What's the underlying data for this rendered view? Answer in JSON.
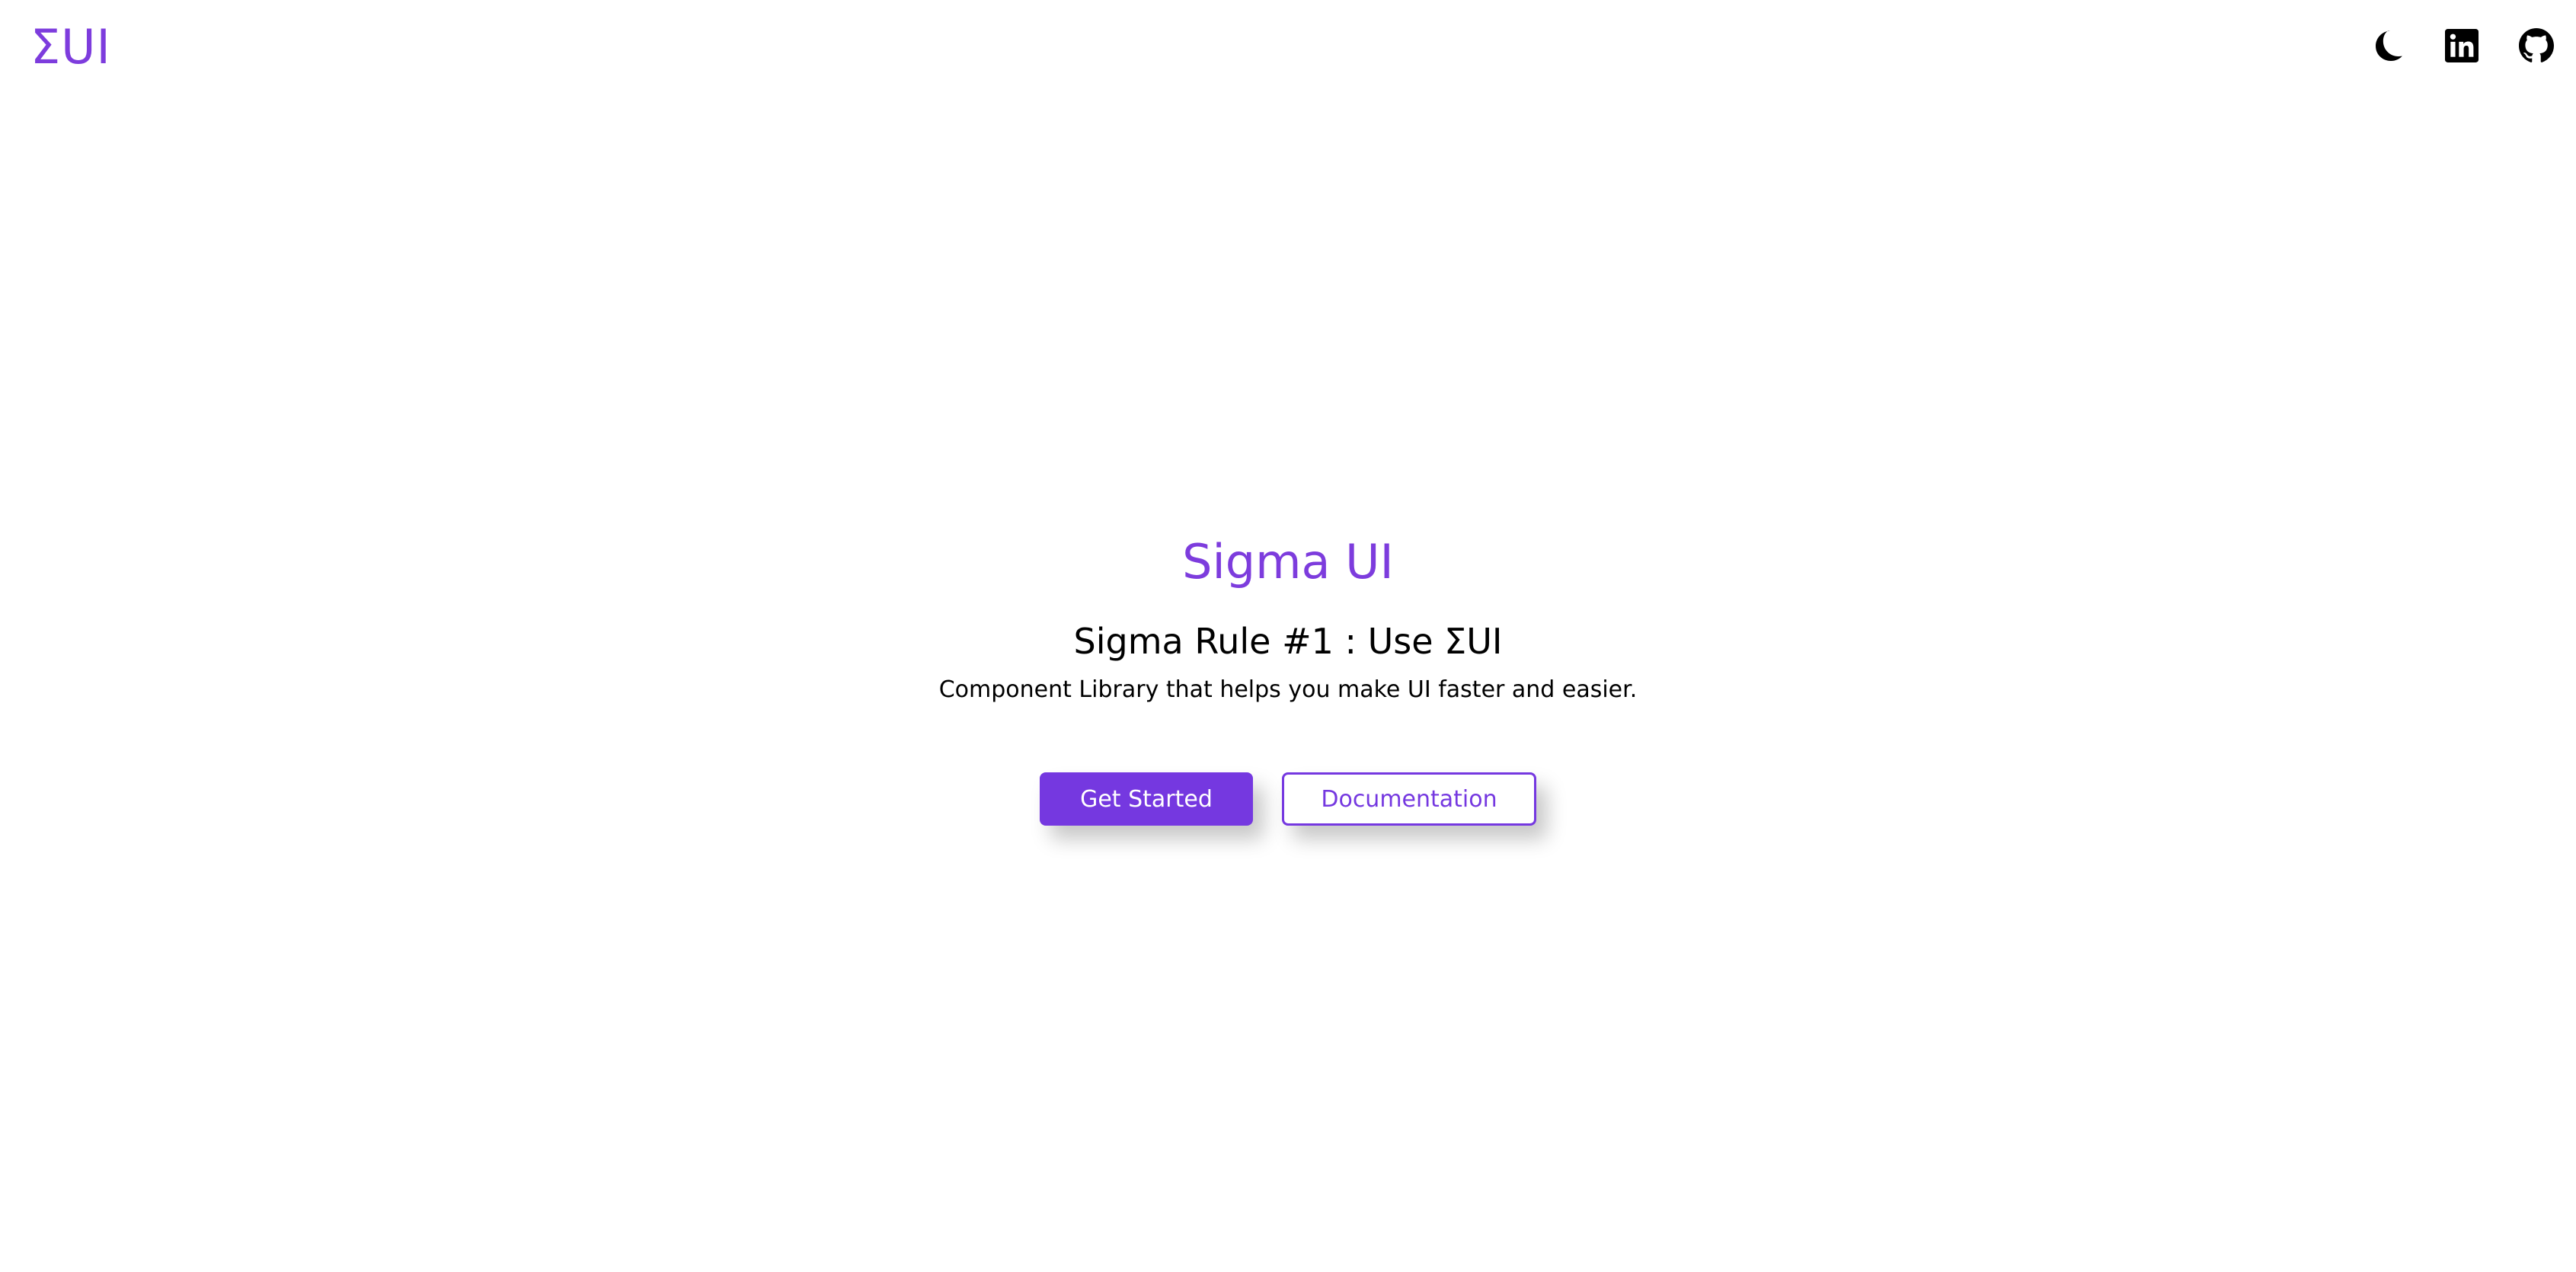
{
  "navbar": {
    "logo": "ΣUI",
    "icons": [
      {
        "name": "moon-icon",
        "label": "Toggle dark mode"
      },
      {
        "name": "linkedin-icon",
        "label": "LinkedIn"
      },
      {
        "name": "github-icon",
        "label": "GitHub"
      }
    ]
  },
  "hero": {
    "title": "Sigma UI",
    "tagline": "Sigma Rule #1 : Use ΣUI",
    "description": "Component Library that helps you make UI faster and easier."
  },
  "actions": {
    "primary_label": "Get Started",
    "secondary_label": "Documentation"
  },
  "colors": {
    "accent": "#7538e0",
    "brand_text": "#7d3cdd",
    "text": "#000000",
    "background": "#ffffff"
  }
}
